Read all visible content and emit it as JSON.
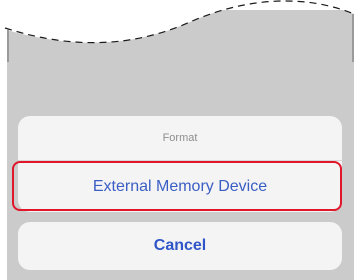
{
  "action_sheet": {
    "title": "Format",
    "option_label": "External Memory Device",
    "cancel_label": "Cancel"
  },
  "colors": {
    "accent": "#3a5ec4",
    "highlight": "#e0162b",
    "dim_background": "#cbcbcb",
    "sheet_background": "#f4f4f4"
  }
}
